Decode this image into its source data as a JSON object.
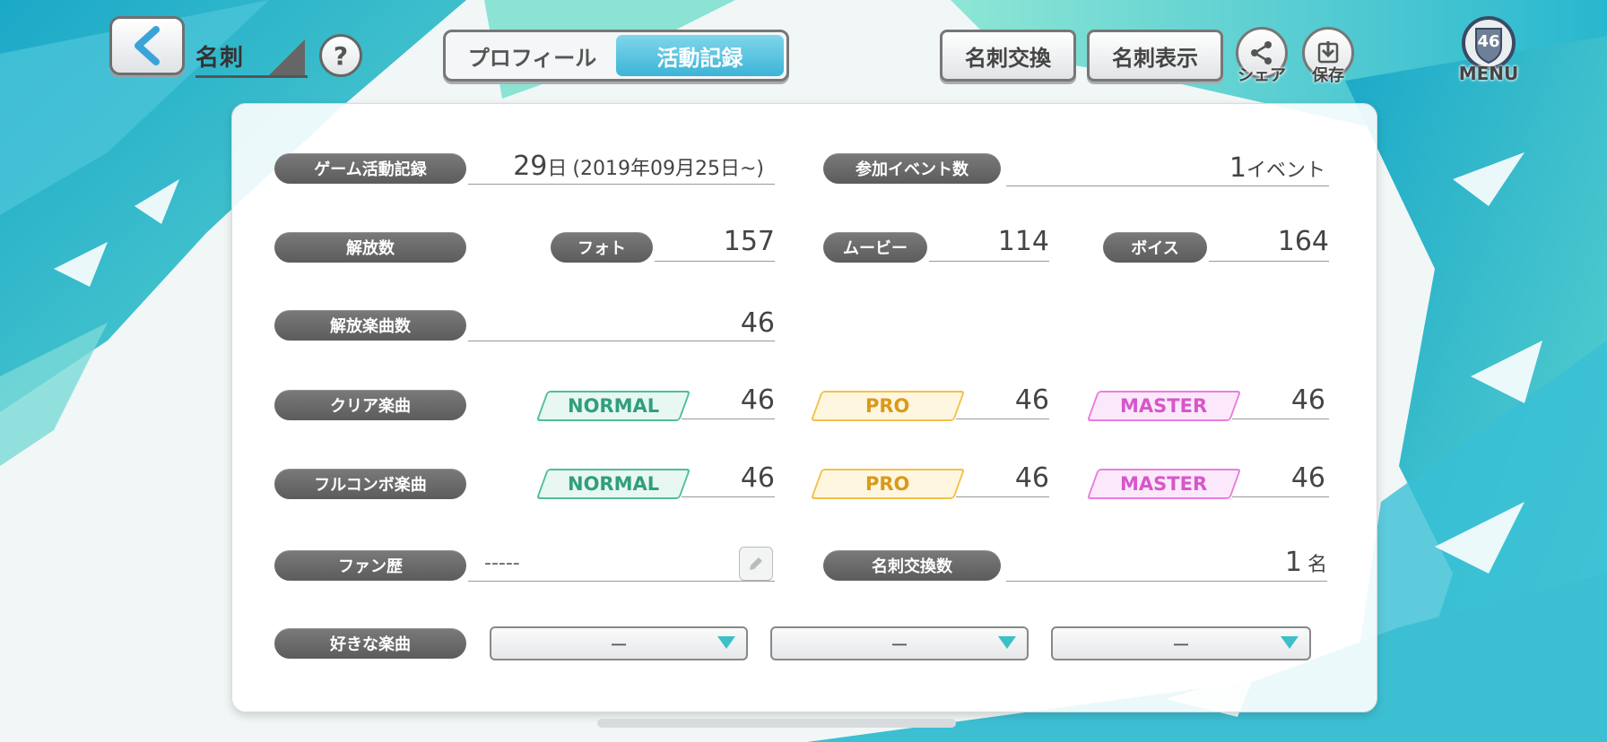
{
  "header": {
    "page_title": "名刺",
    "help_label": "?",
    "tabs": [
      {
        "label": "プロフィール",
        "active": false
      },
      {
        "label": "活動記録",
        "active": true
      }
    ],
    "exchange_button": "名刺交換",
    "display_button": "名刺表示",
    "share_label": "シェア",
    "save_label": "保存",
    "menu_label": "MENU",
    "menu_badge": "46"
  },
  "records": {
    "game_activity": {
      "label": "ゲーム活動記録",
      "days": "29",
      "day_unit": "日",
      "since": "(2019年09月25日~)"
    },
    "events": {
      "label": "参加イベント数",
      "value": "1",
      "unit": "イベント"
    },
    "unlocks": {
      "label": "解放数",
      "items": [
        {
          "label": "フォト",
          "value": "157"
        },
        {
          "label": "ムービー",
          "value": "114"
        },
        {
          "label": "ボイス",
          "value": "164"
        }
      ]
    },
    "unlocked_songs": {
      "label": "解放楽曲数",
      "value": "46"
    },
    "cleared_songs": {
      "label": "クリア楽曲",
      "items": [
        {
          "difficulty": "NORMAL",
          "value": "46"
        },
        {
          "difficulty": "PRO",
          "value": "46"
        },
        {
          "difficulty": "MASTER",
          "value": "46"
        }
      ]
    },
    "full_combo_songs": {
      "label": "フルコンボ楽曲",
      "items": [
        {
          "difficulty": "NORMAL",
          "value": "46"
        },
        {
          "difficulty": "PRO",
          "value": "46"
        },
        {
          "difficulty": "MASTER",
          "value": "46"
        }
      ]
    },
    "fan_history": {
      "label": "ファン歴",
      "value": "-----"
    },
    "card_exchanges": {
      "label": "名刺交換数",
      "value": "1",
      "unit": "名"
    },
    "favorite_songs": {
      "label": "好きな楽曲",
      "slots": [
        "ー",
        "ー",
        "ー"
      ]
    }
  },
  "colors": {
    "accent": "#3cb4d8",
    "label_bg": "#666666",
    "normal": "#2f9f7d",
    "pro": "#d99a1b",
    "master": "#d657c9"
  }
}
